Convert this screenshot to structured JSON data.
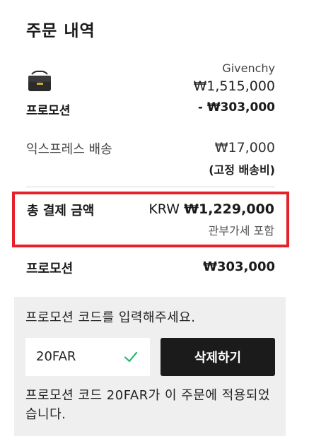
{
  "order": {
    "title": "주문 내역",
    "item": {
      "brand": "Givenchy",
      "price": "₩1,515,000",
      "thumbnail_icon": "handbag-icon"
    },
    "promotion": {
      "label": "프로모션",
      "discount": "- ₩303,000"
    },
    "shipping": {
      "label": "익스프레스 배송",
      "cost": "₩17,000",
      "note": "(고정 배송비)"
    },
    "total": {
      "label": "총 결제 금액",
      "currency": "KRW",
      "amount": "₩1,229,000",
      "vat_note": "관부가세 포함",
      "highlight_color": "#e5212a"
    },
    "promotion_summary": {
      "label": "프로모션",
      "amount": "₩303,000"
    }
  },
  "promo_code": {
    "prompt": "프로모션 코드를 입력해주세요.",
    "input_value": "20FAR",
    "check_icon": "checkmark-icon",
    "check_color": "#2bb673",
    "delete_button": "삭제하기",
    "applied_message": "프로모션 코드 20FAR가 이 주문에 적용되었습니다."
  }
}
